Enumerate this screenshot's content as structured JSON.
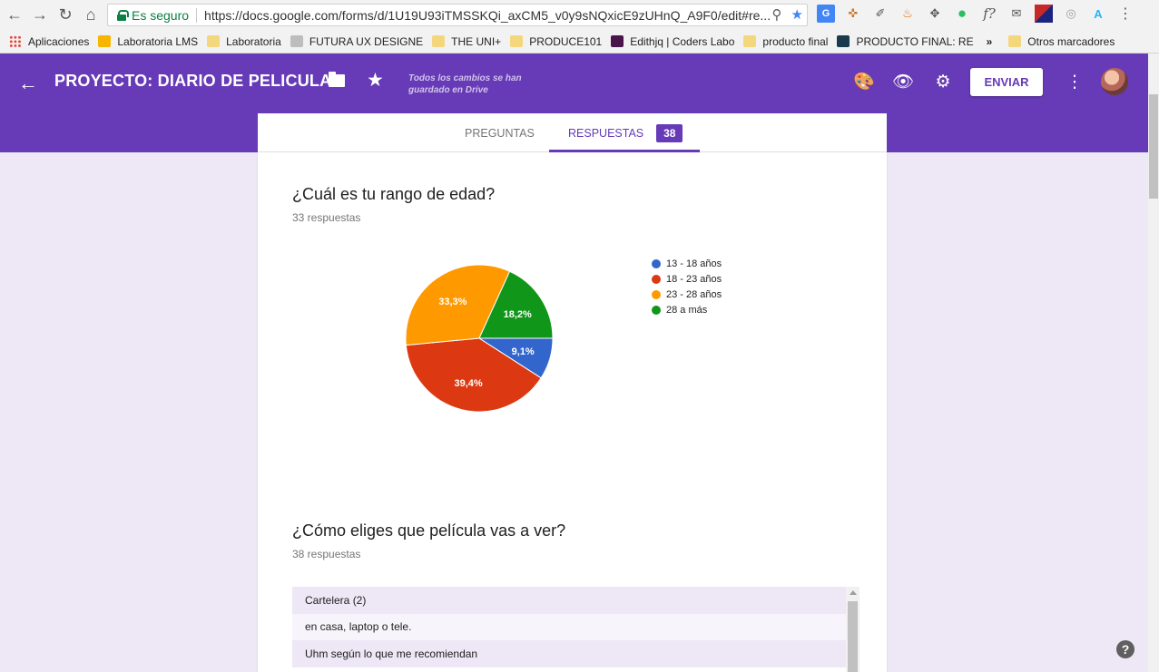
{
  "browser": {
    "security_label": "Es seguro",
    "url": "https://docs.google.com/forms/d/1U19U93iTMSSKQi_axCM5_v0y9sNQxicE9zUHnQ_A9F0/edit#re...",
    "bookmarks": [
      {
        "label": "Aplicaciones",
        "icon": "apps-grid-icon",
        "color": "#e8453c"
      },
      {
        "label": "Laboratoria LMS",
        "icon": "laboratoria-icon",
        "color": "#f7b500"
      },
      {
        "label": "Laboratoria",
        "icon": "folder-icon",
        "color": "#f4d77c"
      },
      {
        "label": "FUTURA UX DESIGNE",
        "icon": "site-icon",
        "color": "#9e9e9e"
      },
      {
        "label": "THE UNI+",
        "icon": "folder-icon",
        "color": "#f4d77c"
      },
      {
        "label": "PRODUCE101",
        "icon": "folder-icon",
        "color": "#f4d77c"
      },
      {
        "label": "Edithjq | Coders Labo",
        "icon": "hash-icon",
        "color": "#4a154b"
      },
      {
        "label": "producto final",
        "icon": "folder-icon",
        "color": "#f4d77c"
      },
      {
        "label": "PRODUCTO FINAL: RE",
        "icon": "trello-icon",
        "color": "#1b3a4b"
      }
    ],
    "overflow_label": "»",
    "other_bookmarks": "Otros marcadores"
  },
  "header": {
    "title": "PROYECTO: DIARIO DE PELICULAS",
    "save_status": "Todos los cambios se han guardado en Drive",
    "send_label": "ENVIAR",
    "accent": "#673ab7"
  },
  "tabs": {
    "questions_label": "PREGUNTAS",
    "responses_label": "RESPUESTAS",
    "responses_count": "38"
  },
  "question1": {
    "title": "¿Cuál es tu rango de edad?",
    "count": "33 respuestas"
  },
  "chart_data": {
    "type": "pie",
    "categories": [
      "13 - 18 años",
      "18 - 23 años",
      "23 - 28 años",
      "28 a más"
    ],
    "values": [
      9.1,
      39.4,
      33.3,
      18.2
    ],
    "labels": [
      "9,1%",
      "39,4%",
      "33,3%",
      "18,2%"
    ],
    "colors": [
      "#3366cc",
      "#dc3912",
      "#ff9900",
      "#109618"
    ],
    "legend_position": "right"
  },
  "question2": {
    "title": "¿Cómo eliges que película vas a ver?",
    "count": "38 respuestas",
    "answers": [
      "Cartelera (2)",
      "en casa, laptop o tele.",
      "Uhm según lo que me recomiendan"
    ]
  },
  "help_label": "?"
}
